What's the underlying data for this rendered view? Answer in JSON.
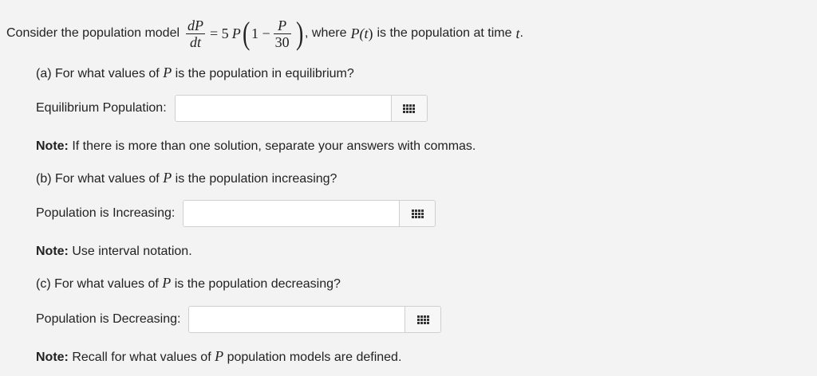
{
  "intro": {
    "prefix": "Consider the population model",
    "frac1_num": "dP",
    "frac1_den": "dt",
    "equals_part": "= 5",
    "var_P": "P",
    "one_minus": "1 −",
    "frac2_num": "P",
    "frac2_den": "30",
    "paren_open": "(",
    "paren_close": ")",
    "where_text": ", where",
    "func_Pt": "P(",
    "func_t": "t",
    "func_close": ")",
    "is_text": "is the population at time",
    "time_var": "t",
    "period": "."
  },
  "part_a": {
    "question_pre": "(a) For what values of",
    "var": "P",
    "question_post": "is the population in equilibrium?",
    "field_label": "Equilibrium Population:",
    "value": "",
    "placeholder": "",
    "keypad_icon": "keypad-icon",
    "note_label": "Note:",
    "note_text": "If there is more than one solution, separate your answers with commas."
  },
  "part_b": {
    "question_pre": "(b) For what values of",
    "var": "P",
    "question_post": "is the population increasing?",
    "field_label": "Population is Increasing:",
    "value": "",
    "placeholder": "",
    "keypad_icon": "keypad-icon",
    "note_label": "Note:",
    "note_text": "Use interval notation."
  },
  "part_c": {
    "question_pre": "(c) For what values of",
    "var": "P",
    "question_post": "is the population decreasing?",
    "field_label": "Population is Decreasing:",
    "value": "",
    "placeholder": "",
    "keypad_icon": "keypad-icon",
    "note_label": "Note:",
    "note_text_pre": "Recall for what values of",
    "note_var": "P",
    "note_text_post": "population models are defined."
  }
}
